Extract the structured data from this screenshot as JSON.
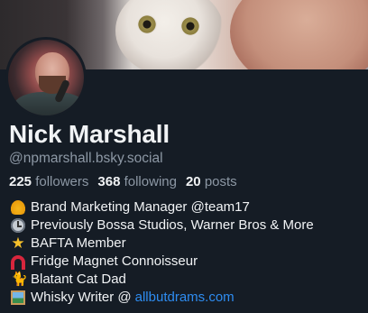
{
  "profile": {
    "display_name": "Nick Marshall",
    "handle": "@npmarshall.bsky.social",
    "stats": {
      "followers_count": "225",
      "followers_label": "followers",
      "following_count": "368",
      "following_label": "following",
      "posts_count": "20",
      "posts_label": "posts"
    },
    "bio": [
      {
        "icon": "bell-icon",
        "text": "Brand Marketing Manager @team17"
      },
      {
        "icon": "clock-icon",
        "text": "Previously Bossa Studios, Warner Bros & More"
      },
      {
        "icon": "star-icon",
        "text": "BAFTA Member"
      },
      {
        "icon": "magnet-icon",
        "text": "Fridge Magnet Connoisseur"
      },
      {
        "icon": "cat-icon",
        "text": "Blatant Cat Dad"
      },
      {
        "icon": "picture-icon",
        "text": "Whisky Writer @",
        "link": "allbutdrams.com"
      }
    ]
  },
  "colors": {
    "background": "#151c25",
    "primary_text": "#f1f3f5",
    "secondary_text": "#8d98a5",
    "link": "#2e8cf0"
  }
}
